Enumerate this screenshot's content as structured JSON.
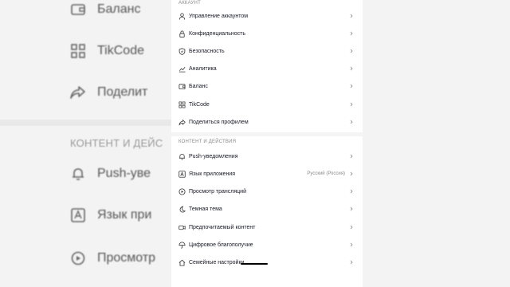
{
  "background": {
    "left_items": [
      {
        "label": "Баланс",
        "icon": "wallet-icon"
      },
      {
        "label": "TikCode",
        "icon": "qr-code-icon"
      },
      {
        "label": "Поделит",
        "icon": "share-icon"
      }
    ],
    "section_label": "КОНТЕНТ И ДЕЙС",
    "left_items_2": [
      {
        "label": "Push-уве",
        "icon": "bell-icon"
      },
      {
        "label": "Язык при",
        "icon": "language-icon"
      },
      {
        "label": "Просмотр",
        "icon": "play-circle-icon"
      }
    ]
  },
  "account_section": {
    "title": "АККАУНТ",
    "items": [
      {
        "label": "Управление аккаунтом",
        "icon": "person-icon"
      },
      {
        "label": "Конфиденциальность",
        "icon": "lock-icon"
      },
      {
        "label": "Безопасность",
        "icon": "shield-icon"
      },
      {
        "label": "Аналитика",
        "icon": "analytics-icon"
      },
      {
        "label": "Баланс",
        "icon": "wallet-icon"
      },
      {
        "label": "TikCode",
        "icon": "qr-code-icon"
      },
      {
        "label": "Поделиться профилем",
        "icon": "share-icon"
      }
    ]
  },
  "content_section": {
    "title": "КОНТЕНТ И ДЕЙСТВИЯ",
    "items": [
      {
        "label": "Push-уведомления",
        "icon": "bell-icon",
        "value": ""
      },
      {
        "label": "Язык приложения",
        "icon": "language-icon",
        "value": "Русский (Россия)"
      },
      {
        "label": "Просмотр трансляций",
        "icon": "play-circle-icon",
        "value": ""
      },
      {
        "label": "Темная тема",
        "icon": "moon-icon",
        "value": ""
      },
      {
        "label": "Предпочитаемый контент",
        "icon": "video-icon",
        "value": ""
      },
      {
        "label": "Цифровое благополучие",
        "icon": "umbrella-icon",
        "value": ""
      },
      {
        "label": "Семейные настройки",
        "icon": "home-icon",
        "value": ""
      }
    ]
  },
  "colors": {
    "text": "#161823",
    "secondary": "#8a8a8a",
    "background": "#ffffff"
  }
}
